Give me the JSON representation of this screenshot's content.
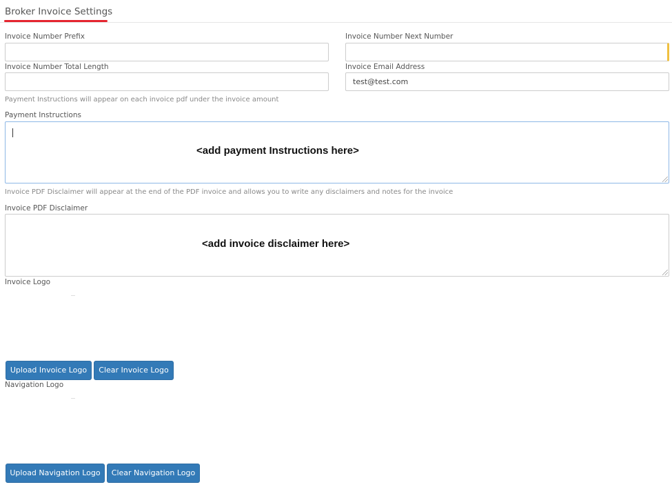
{
  "page": {
    "title": "Broker Invoice Settings",
    "accent_color": "#e5242f",
    "button_color": "#337ab7"
  },
  "fields": {
    "invoice_number_prefix": {
      "label": "Invoice Number Prefix",
      "value": ""
    },
    "invoice_number_next_number": {
      "label": "Invoice Number Next Number",
      "value": ""
    },
    "invoice_number_total_length": {
      "label": "Invoice Number Total Length",
      "value": ""
    },
    "invoice_email_address": {
      "label": "Invoice Email Address",
      "value": "test@test.com"
    }
  },
  "payment_instructions": {
    "help": "Payment Instructions will appear on each invoice pdf under the invoice amount",
    "label": "Payment Instructions",
    "overlay_text": "<add payment Instructions here>"
  },
  "invoice_disclaimer": {
    "help": "Invoice PDF Disclaimer will appear at the end of the PDF invoice and allows you to write any disclaimers and notes for the invoice",
    "label": "Invoice PDF Disclaimer",
    "overlay_text": "<add invoice disclaimer here>"
  },
  "invoice_logo": {
    "label": "Invoice Logo",
    "upload_label": "Upload Invoice Logo",
    "clear_label": "Clear Invoice Logo"
  },
  "navigation_logo": {
    "label": "Navigation Logo",
    "upload_label": "Upload Navigation Logo",
    "clear_label": "Clear Navigation Logo"
  }
}
